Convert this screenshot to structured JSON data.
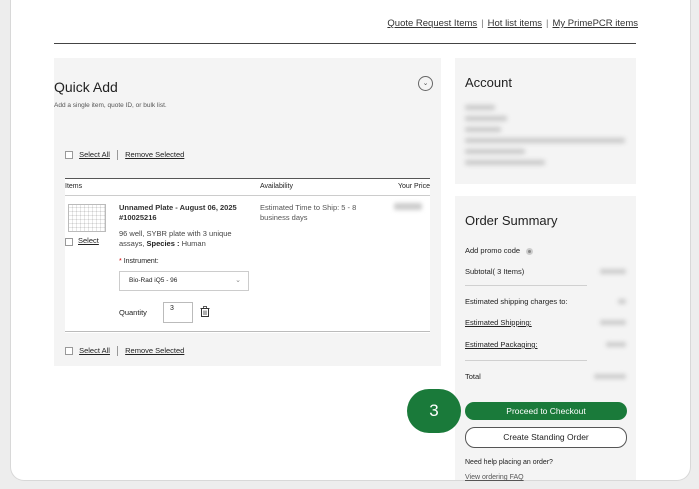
{
  "top_nav": {
    "links": [
      "Quote Request Items",
      "Hot list items",
      "My PrimePCR items"
    ],
    "separator": "|"
  },
  "quick_add": {
    "title": "Quick Add",
    "subtitle": "Add a single item, quote ID, or bulk list.",
    "toggle_icon": "chevron-down-icon",
    "select_all": "Select All",
    "remove_selected": "Remove Selected",
    "columns": [
      "Items",
      "Availability",
      "Your Price"
    ],
    "item": {
      "select_label": "Select",
      "name": "Unnamed Plate - August 06, 2025 #10025216",
      "description_prefix": "96 well, SYBR plate with 3 unique assays,",
      "species_label": "Species :",
      "species_value": "Human",
      "instrument_required_mark": "*",
      "instrument_label": "Instrument:",
      "instrument_value": "Bio-Rad iQ5 - 96",
      "quantity_label": "Quantity",
      "quantity_value": "3",
      "availability": "Estimated Time to Ship: 5 - 8 business days"
    }
  },
  "account": {
    "title": "Account"
  },
  "order_summary": {
    "title": "Order Summary",
    "promo_label": "Add promo code",
    "subtotal_label": "Subtotal( 3 Items)",
    "shipping_charges_label": "Estimated shipping charges to:",
    "estimated_shipping_label": "Estimated Shipping:",
    "estimated_packaging_label": "Estimated Packaging:",
    "total_label": "Total",
    "checkout_button": "Proceed to Checkout",
    "standing_order_button": "Create Standing Order",
    "help_text": "Need help placing an order?",
    "faq_link": "View ordering FAQ"
  },
  "step_badge": "3",
  "colors": {
    "accent_green": "#1a7a3a",
    "card_bg": "#f4f4f4"
  }
}
